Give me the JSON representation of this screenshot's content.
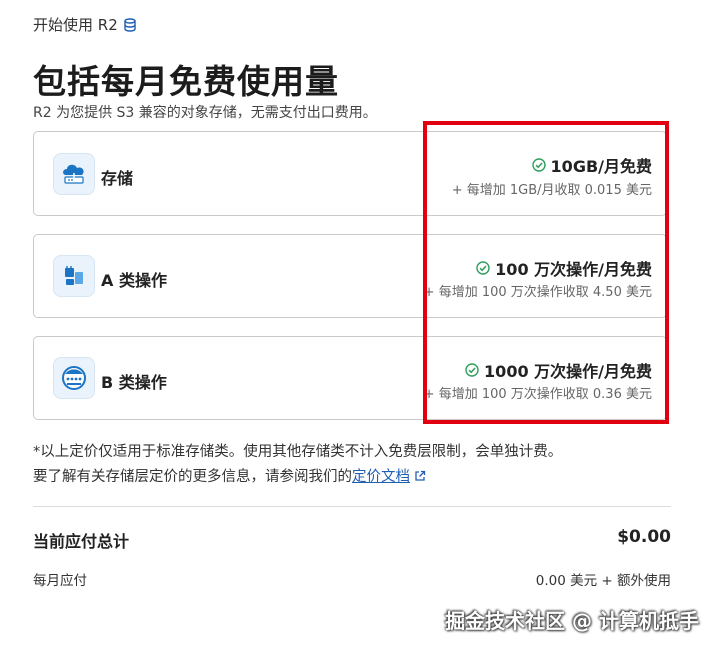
{
  "top_link": {
    "label": "开始使用 R2",
    "icon": "database-icon"
  },
  "title": "包括每月免费使用量",
  "subtitle": "R2 为您提供 S3 兼容的对象存储，无需支付出口费用。",
  "cards": [
    {
      "label": "存储",
      "icon": "cloud-storage-icon",
      "free": "10GB/月免费",
      "extra": "+ 每增加 1GB/月收取 0.015 美元"
    },
    {
      "label": "A 类操作",
      "icon": "class-a-operations-icon",
      "free": "100 万次操作/月免费",
      "extra": "+ 每增加 100 万次操作收取 4.50 美元"
    },
    {
      "label": "B 类操作",
      "icon": "class-b-operations-icon",
      "free": "1000 万次操作/月免费",
      "extra": "+ 每增加 100 万次操作收取 0.36 美元"
    }
  ],
  "note": {
    "line1": "*以上定价仅适用于标准存储类。使用其他存储类不计入免费层限制，会单独计费。",
    "line2_prefix": "要了解有关存储层定价的更多信息，请参阅我们的",
    "link": "定价文档"
  },
  "summary": {
    "total_label": "当前应付总计",
    "total_value": "$0.00",
    "monthly_label": "每月应付",
    "monthly_value": "0.00 美元 + 额外使用"
  },
  "watermark": "掘金技术社区 @ 计算机抵手",
  "colors": {
    "accent_link": "#1f5fb3",
    "check_green": "#2e9e5b",
    "highlight_red": "#e00010",
    "icon_blue": "#1b74c4"
  }
}
